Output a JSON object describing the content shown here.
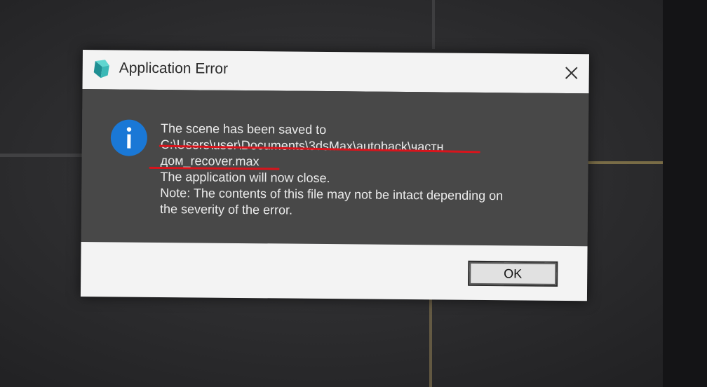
{
  "dialog": {
    "title": "Application Error",
    "app_icon": "3dsmax-icon",
    "close_icon": "close-icon",
    "info_icon": "info-icon",
    "message": {
      "line1": "The scene has been saved to",
      "path_line1": "C:\\Users\\user\\Documents\\3dsMax\\autoback\\частн",
      "path_line2": "дом_recover.max",
      "line3": "The application will now close.",
      "line4": "Note: The contents of this file may not be intact depending on",
      "line5": "the severity of the error."
    },
    "ok_label": "OK"
  },
  "colors": {
    "content_bg": "#484848",
    "titlebar_bg": "#f3f3f3",
    "info_blue": "#1a78d6",
    "redaction_red": "#d8141c"
  }
}
